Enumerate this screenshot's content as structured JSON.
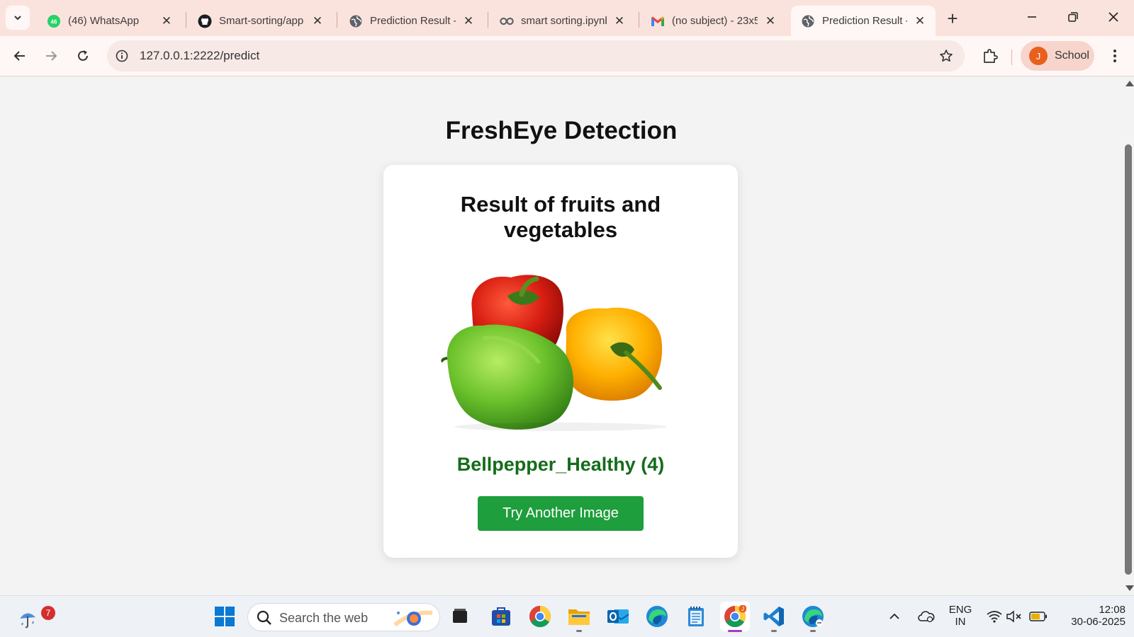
{
  "browser": {
    "tabs": [
      {
        "title": "(46) WhatsApp",
        "favicon": "whatsapp-icon"
      },
      {
        "title": "Smart-sorting/app",
        "favicon": "github-icon"
      },
      {
        "title": "Prediction Result -",
        "favicon": "globe-icon"
      },
      {
        "title": "smart sorting.ipynb",
        "favicon": "colab-icon"
      },
      {
        "title": "(no subject) - 23x5",
        "favicon": "gmail-icon"
      },
      {
        "title": "Prediction Result -",
        "favicon": "globe-icon",
        "active": true
      }
    ],
    "whatsapp_badge": "46",
    "url": "127.0.0.1:2222/predict",
    "profile_initial": "J",
    "profile_name": "School"
  },
  "page": {
    "title": "FreshEye Detection",
    "card_title": "Result of fruits and vegetables",
    "result_label": "Bellpepper_Healthy (4)",
    "button_label": "Try Another Image",
    "image_desc_icon": "bellpepper-image",
    "colors": {
      "result_label": "#146c1a",
      "button_bg": "#1e9e3c"
    }
  },
  "taskbar": {
    "weather_badge": "7",
    "search_placeholder": "Search the web",
    "lang_line1": "ENG",
    "lang_line2": "IN",
    "time": "12:08",
    "date": "30-06-2025",
    "chrome_profile_badge": "J"
  }
}
